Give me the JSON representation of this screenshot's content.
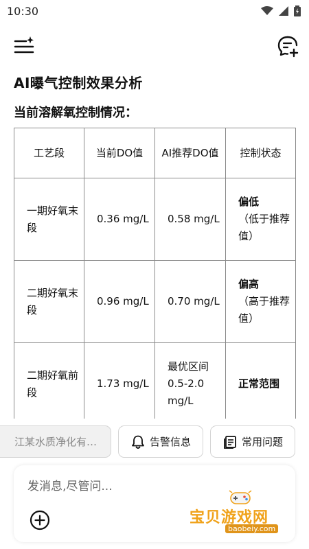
{
  "status_bar": {
    "time": "10:30"
  },
  "page": {
    "title": "AI曝气控制效果分析",
    "subtitle": "当前溶解氧控制情况："
  },
  "table": {
    "headers": [
      "工艺段",
      "当前DO值",
      "AI推荐DO值",
      "控制状态"
    ],
    "rows": [
      {
        "segment": "一期好氧末段",
        "current": "0.36 mg/L",
        "recommended": "0.58 mg/L",
        "status": "偏低",
        "status_note": "（低于推荐值）"
      },
      {
        "segment": "二期好氧末段",
        "current": "0.96 mg/L",
        "recommended": "0.70 mg/L",
        "status": "偏高",
        "status_note": "（高于推荐值）"
      },
      {
        "segment": "二期好氧前段",
        "current": "1.73 mg/L",
        "recommended": "最优区间 0.5-2.0 mg/L",
        "status": "正常范围",
        "status_note": ""
      }
    ]
  },
  "chips": {
    "company": "江某水质净化有…",
    "alarm": "告警信息",
    "faq": "常用问题"
  },
  "composer": {
    "placeholder": "发消息,尽管问..."
  },
  "watermark": {
    "text": "宝贝游戏网",
    "url": "baobeiy.com"
  },
  "colors": {
    "accent": "#111111",
    "watermark": "#f0a21a"
  }
}
